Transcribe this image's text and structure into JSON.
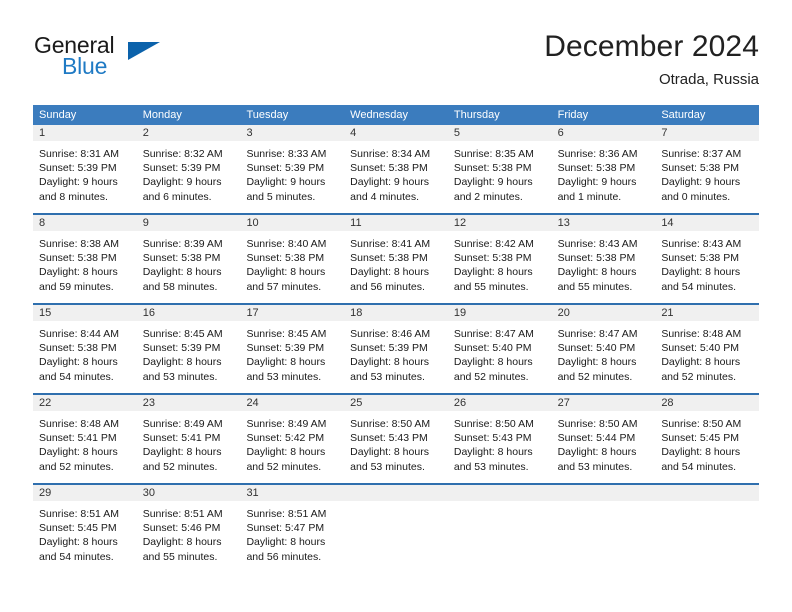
{
  "brand": {
    "word_one": "General",
    "word_two": "Blue",
    "logo_icon": "triangle-logo-icon",
    "accent_color": "#0b62ab",
    "blue_text_color": "#1f7ac4"
  },
  "header": {
    "month_title": "December 2024",
    "location": "Otrada, Russia"
  },
  "calendar": {
    "header_color": "#3b7cbe",
    "row_border_color": "#2f6fae",
    "day_band_color": "#f0f0f0",
    "weekdays": [
      "Sunday",
      "Monday",
      "Tuesday",
      "Wednesday",
      "Thursday",
      "Friday",
      "Saturday"
    ],
    "weeks": [
      [
        {
          "day": "1",
          "lines": [
            "Sunrise: 8:31 AM",
            "Sunset: 5:39 PM",
            "Daylight: 9 hours",
            "and 8 minutes."
          ]
        },
        {
          "day": "2",
          "lines": [
            "Sunrise: 8:32 AM",
            "Sunset: 5:39 PM",
            "Daylight: 9 hours",
            "and 6 minutes."
          ]
        },
        {
          "day": "3",
          "lines": [
            "Sunrise: 8:33 AM",
            "Sunset: 5:39 PM",
            "Daylight: 9 hours",
            "and 5 minutes."
          ]
        },
        {
          "day": "4",
          "lines": [
            "Sunrise: 8:34 AM",
            "Sunset: 5:38 PM",
            "Daylight: 9 hours",
            "and 4 minutes."
          ]
        },
        {
          "day": "5",
          "lines": [
            "Sunrise: 8:35 AM",
            "Sunset: 5:38 PM",
            "Daylight: 9 hours",
            "and 2 minutes."
          ]
        },
        {
          "day": "6",
          "lines": [
            "Sunrise: 8:36 AM",
            "Sunset: 5:38 PM",
            "Daylight: 9 hours",
            "and 1 minute."
          ]
        },
        {
          "day": "7",
          "lines": [
            "Sunrise: 8:37 AM",
            "Sunset: 5:38 PM",
            "Daylight: 9 hours",
            "and 0 minutes."
          ]
        }
      ],
      [
        {
          "day": "8",
          "lines": [
            "Sunrise: 8:38 AM",
            "Sunset: 5:38 PM",
            "Daylight: 8 hours",
            "and 59 minutes."
          ]
        },
        {
          "day": "9",
          "lines": [
            "Sunrise: 8:39 AM",
            "Sunset: 5:38 PM",
            "Daylight: 8 hours",
            "and 58 minutes."
          ]
        },
        {
          "day": "10",
          "lines": [
            "Sunrise: 8:40 AM",
            "Sunset: 5:38 PM",
            "Daylight: 8 hours",
            "and 57 minutes."
          ]
        },
        {
          "day": "11",
          "lines": [
            "Sunrise: 8:41 AM",
            "Sunset: 5:38 PM",
            "Daylight: 8 hours",
            "and 56 minutes."
          ]
        },
        {
          "day": "12",
          "lines": [
            "Sunrise: 8:42 AM",
            "Sunset: 5:38 PM",
            "Daylight: 8 hours",
            "and 55 minutes."
          ]
        },
        {
          "day": "13",
          "lines": [
            "Sunrise: 8:43 AM",
            "Sunset: 5:38 PM",
            "Daylight: 8 hours",
            "and 55 minutes."
          ]
        },
        {
          "day": "14",
          "lines": [
            "Sunrise: 8:43 AM",
            "Sunset: 5:38 PM",
            "Daylight: 8 hours",
            "and 54 minutes."
          ]
        }
      ],
      [
        {
          "day": "15",
          "lines": [
            "Sunrise: 8:44 AM",
            "Sunset: 5:38 PM",
            "Daylight: 8 hours",
            "and 54 minutes."
          ]
        },
        {
          "day": "16",
          "lines": [
            "Sunrise: 8:45 AM",
            "Sunset: 5:39 PM",
            "Daylight: 8 hours",
            "and 53 minutes."
          ]
        },
        {
          "day": "17",
          "lines": [
            "Sunrise: 8:45 AM",
            "Sunset: 5:39 PM",
            "Daylight: 8 hours",
            "and 53 minutes."
          ]
        },
        {
          "day": "18",
          "lines": [
            "Sunrise: 8:46 AM",
            "Sunset: 5:39 PM",
            "Daylight: 8 hours",
            "and 53 minutes."
          ]
        },
        {
          "day": "19",
          "lines": [
            "Sunrise: 8:47 AM",
            "Sunset: 5:40 PM",
            "Daylight: 8 hours",
            "and 52 minutes."
          ]
        },
        {
          "day": "20",
          "lines": [
            "Sunrise: 8:47 AM",
            "Sunset: 5:40 PM",
            "Daylight: 8 hours",
            "and 52 minutes."
          ]
        },
        {
          "day": "21",
          "lines": [
            "Sunrise: 8:48 AM",
            "Sunset: 5:40 PM",
            "Daylight: 8 hours",
            "and 52 minutes."
          ]
        }
      ],
      [
        {
          "day": "22",
          "lines": [
            "Sunrise: 8:48 AM",
            "Sunset: 5:41 PM",
            "Daylight: 8 hours",
            "and 52 minutes."
          ]
        },
        {
          "day": "23",
          "lines": [
            "Sunrise: 8:49 AM",
            "Sunset: 5:41 PM",
            "Daylight: 8 hours",
            "and 52 minutes."
          ]
        },
        {
          "day": "24",
          "lines": [
            "Sunrise: 8:49 AM",
            "Sunset: 5:42 PM",
            "Daylight: 8 hours",
            "and 52 minutes."
          ]
        },
        {
          "day": "25",
          "lines": [
            "Sunrise: 8:50 AM",
            "Sunset: 5:43 PM",
            "Daylight: 8 hours",
            "and 53 minutes."
          ]
        },
        {
          "day": "26",
          "lines": [
            "Sunrise: 8:50 AM",
            "Sunset: 5:43 PM",
            "Daylight: 8 hours",
            "and 53 minutes."
          ]
        },
        {
          "day": "27",
          "lines": [
            "Sunrise: 8:50 AM",
            "Sunset: 5:44 PM",
            "Daylight: 8 hours",
            "and 53 minutes."
          ]
        },
        {
          "day": "28",
          "lines": [
            "Sunrise: 8:50 AM",
            "Sunset: 5:45 PM",
            "Daylight: 8 hours",
            "and 54 minutes."
          ]
        }
      ],
      [
        {
          "day": "29",
          "lines": [
            "Sunrise: 8:51 AM",
            "Sunset: 5:45 PM",
            "Daylight: 8 hours",
            "and 54 minutes."
          ]
        },
        {
          "day": "30",
          "lines": [
            "Sunrise: 8:51 AM",
            "Sunset: 5:46 PM",
            "Daylight: 8 hours",
            "and 55 minutes."
          ]
        },
        {
          "day": "31",
          "lines": [
            "Sunrise: 8:51 AM",
            "Sunset: 5:47 PM",
            "Daylight: 8 hours",
            "and 56 minutes."
          ]
        },
        {
          "day": "",
          "lines": []
        },
        {
          "day": "",
          "lines": []
        },
        {
          "day": "",
          "lines": []
        },
        {
          "day": "",
          "lines": []
        }
      ]
    ]
  }
}
